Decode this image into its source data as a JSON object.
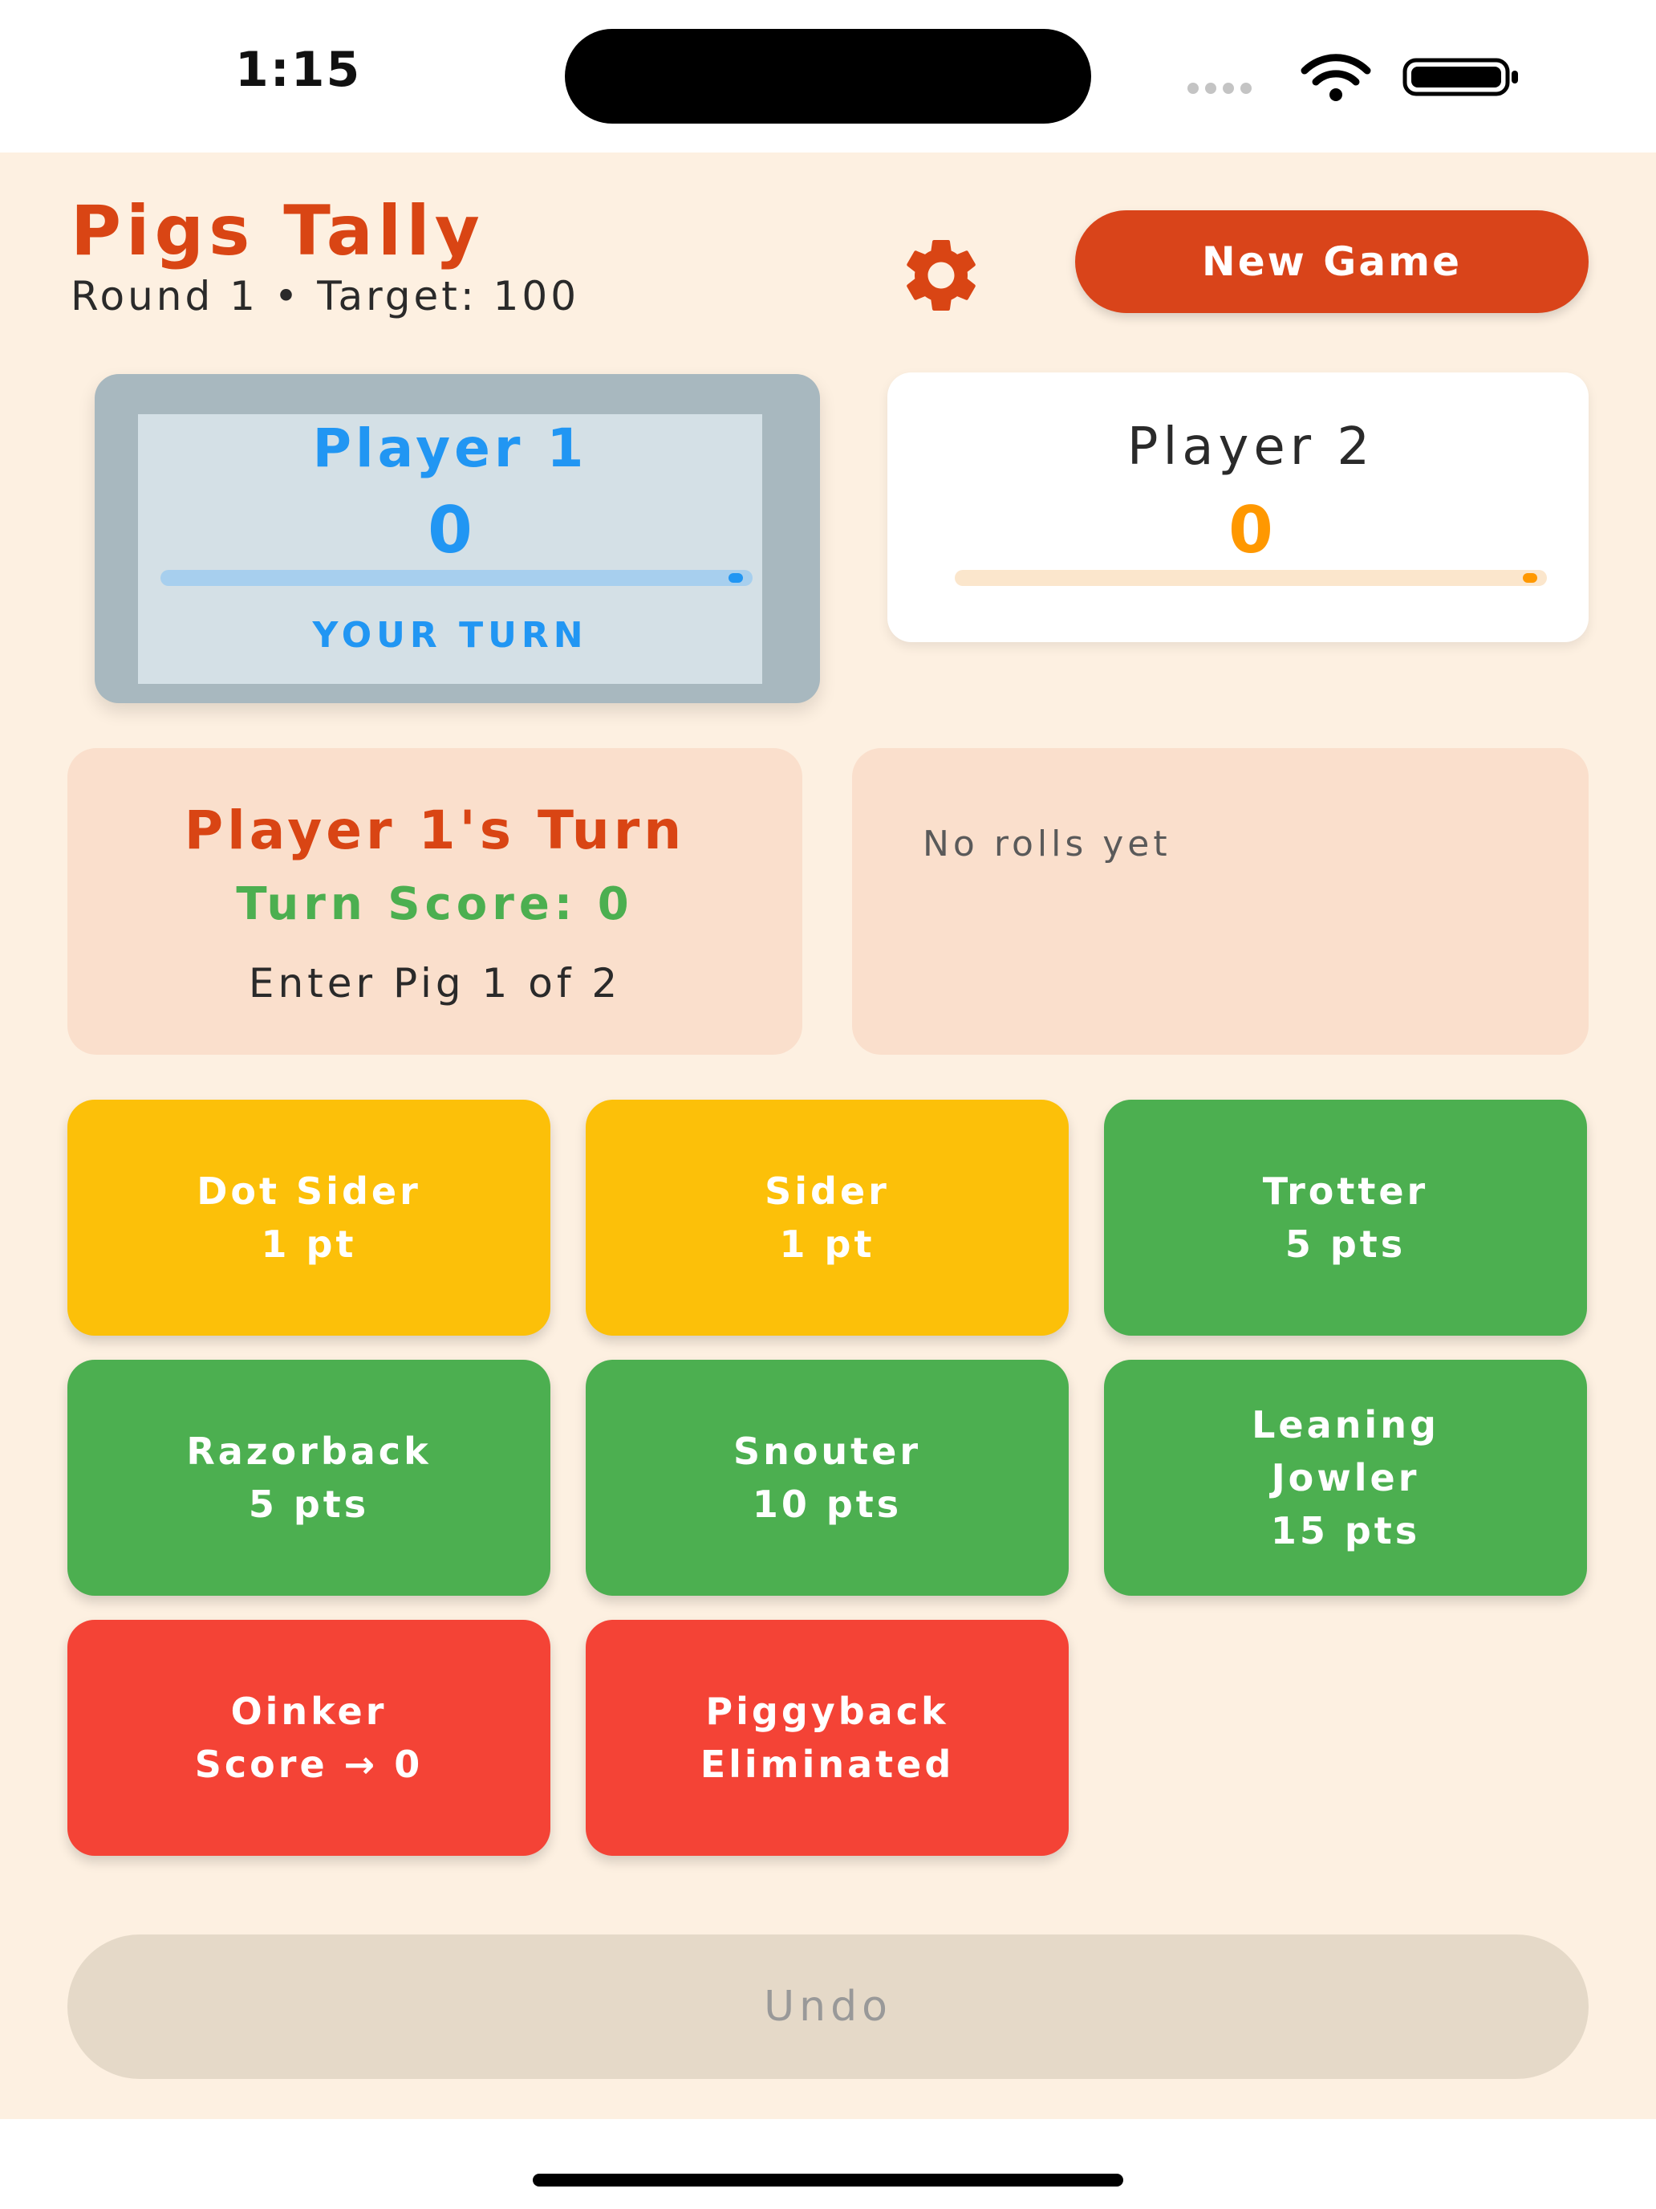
{
  "status": {
    "time": "1:15"
  },
  "header": {
    "title": "Pigs Tally",
    "subtitle": "Round 1 • Target: 100",
    "new_game_label": "New Game"
  },
  "players": [
    {
      "name": "Player 1",
      "score": "0",
      "turn_label": "YOUR TURN",
      "progress": 0,
      "active": true
    },
    {
      "name": "Player 2",
      "score": "0",
      "progress": 0,
      "active": false
    }
  ],
  "turn": {
    "title": "Player 1's Turn",
    "score": "Turn Score: 0",
    "prompt": "Enter Pig 1 of 2"
  },
  "rolls": {
    "empty_text": "No rolls yet"
  },
  "roll_buttons": [
    {
      "label": "Dot Sider",
      "value": "1 pt",
      "color": "#fcc009"
    },
    {
      "label": "Sider",
      "value": "1 pt",
      "color": "#fcc009"
    },
    {
      "label": "Trotter",
      "value": "5 pts",
      "color": "#4caf50"
    },
    {
      "label": "Razorback",
      "value": "5 pts",
      "color": "#4caf50"
    },
    {
      "label": "Snouter",
      "value": "10 pts",
      "color": "#4caf50"
    },
    {
      "label": "Leaning Jowler",
      "value": "15 pts",
      "color": "#4caf50"
    },
    {
      "label": "Oinker",
      "value": "Score → 0",
      "color": "#f44336"
    },
    {
      "label": "Piggyback",
      "value": "Eliminated",
      "color": "#f44336"
    }
  ],
  "undo_label": "Undo",
  "colors": {
    "accent": "#d94514",
    "player1": "#2196f3",
    "player2": "#ff9800",
    "background": "#fdf0e1"
  }
}
